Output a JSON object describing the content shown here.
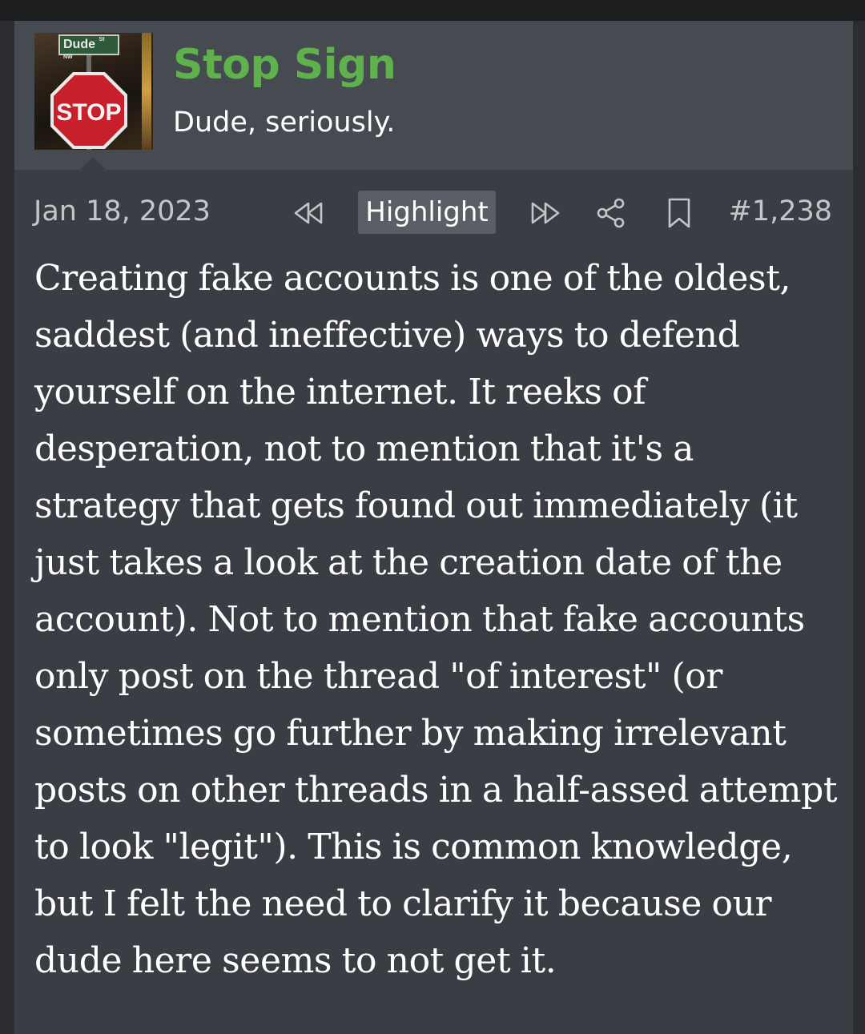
{
  "user": {
    "name": "Stop Sign",
    "title": "Dude, seriously.",
    "avatar": {
      "sign_text": "STOP",
      "street_sign_text": "Dude",
      "street_sign_suffix_top": "St",
      "street_sign_suffix_bottom": "NW"
    }
  },
  "post": {
    "date": "Jan 18, 2023",
    "highlight_label": "Highlight",
    "number": "#1,238",
    "body": "Creating fake accounts is one of the oldest, saddest (and ineffective) ways to defend yourself on the internet. It reeks of desperation, not to mention that it's a strategy that gets found out immediately (it just takes a look at the creation date of the account). Not to mention that fake accounts only post on the thread \"of interest\" (or sometimes go further by making irrelevant posts on other threads in a half-assed attempt to look \"legit\"). This is common knowledge, but I felt the need to clarify it because our dude here seems to not get it."
  },
  "icons": {
    "prev": "rewind-icon",
    "next": "fast-forward-icon",
    "share": "share-icon",
    "bookmark": "bookmark-icon"
  },
  "colors": {
    "username": "#5fb14c",
    "card_bg": "#3a3d44",
    "userbar_bg": "#464a51",
    "highlight_bg": "#5b5e64"
  }
}
